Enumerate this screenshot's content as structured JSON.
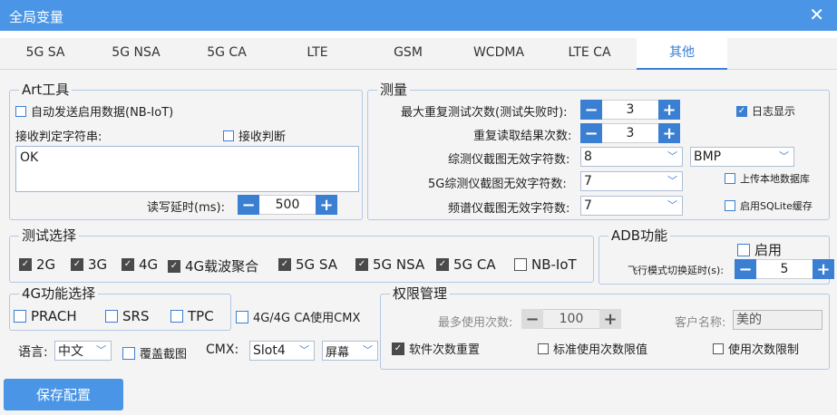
{
  "window": {
    "title": "全局变量",
    "close": "✕"
  },
  "tabs": [
    "5G SA",
    "5G NSA",
    "5G CA",
    "LTE",
    "GSM",
    "WCDMA",
    "LTE CA",
    "其他"
  ],
  "art": {
    "title": "Art工具",
    "auto_send": "自动发送启用数据(NB-IoT)",
    "recv_string": "接收判定字符串:",
    "recv_judge": "接收判断",
    "textarea": "OK",
    "rw_delay_label": "读写延时(ms):",
    "rw_delay": "500"
  },
  "measure": {
    "title": "测量",
    "max_retry_label": "最大重复测试次数(测试失败时):",
    "max_retry": "3",
    "re_read_label": "重复读取结果次数:",
    "re_read": "3",
    "snap_label": "综测仪截图无效字符数:",
    "snap_value": "8",
    "format": "BMP",
    "snap5g_label": "5G综测仪截图无效字符数:",
    "snap5g_value": "7",
    "spec_label": "频谱仪截图无效字符数:",
    "spec_value": "7",
    "log_display": "日志显示",
    "upload_db": "上传本地数据库",
    "sqlite_cache": "启用SQLite缓存"
  },
  "test_select": {
    "title": "测试选择",
    "items": [
      "2G",
      "3G",
      "4G",
      "4G载波聚合",
      "5G SA",
      "5G NSA",
      "5G CA",
      "NB-IoT"
    ]
  },
  "adb": {
    "title": "ADB功能",
    "enable": "启用",
    "airplane_label": "飞行模式切换延时(s):",
    "airplane_value": "5"
  },
  "func4g": {
    "title": "4G功能选择",
    "items": [
      "PRACH",
      "SRS",
      "TPC"
    ]
  },
  "cmx_use": "4G/4G  CA使用CMX",
  "perm": {
    "title": "权限管理",
    "max_use_label": "最多使用次数:",
    "max_use": "100",
    "customer_label": "客户名称:",
    "customer": "美的",
    "reset_count": "软件次数重置",
    "std_limit": "标准使用次数限值",
    "use_limit": "使用次数限制"
  },
  "bottom": {
    "lang_label": "语言:",
    "lang": "中文",
    "overlay": "覆盖截图",
    "cmx_label": "CMX:",
    "cmx_slot": "Slot4",
    "screen": "屏幕"
  },
  "save": "保存配置",
  "icons": {
    "check": "✓",
    "minus": "−",
    "plus": "+",
    "chev": "﹀"
  }
}
